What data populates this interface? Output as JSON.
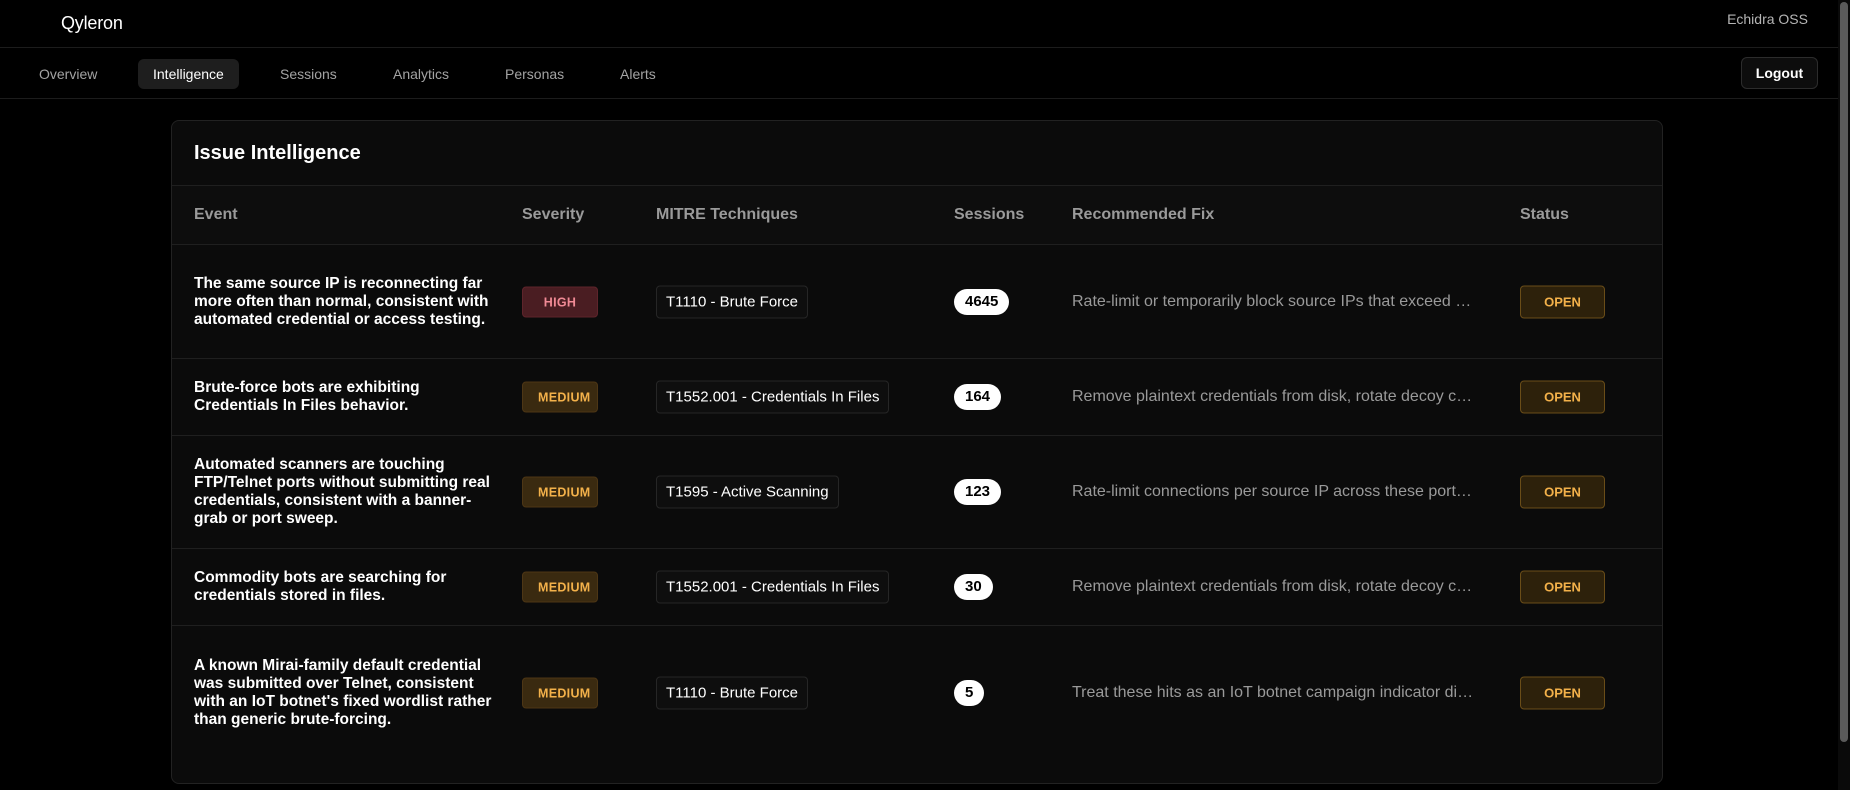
{
  "app": {
    "logo": "Qyleron",
    "org": "Echidra OSS"
  },
  "nav": {
    "tabs": [
      {
        "label": "Overview"
      },
      {
        "label": "Intelligence"
      },
      {
        "label": "Sessions"
      },
      {
        "label": "Analytics"
      },
      {
        "label": "Personas"
      },
      {
        "label": "Alerts"
      }
    ],
    "active_tab": "Intelligence",
    "logout_label": "Logout"
  },
  "card": {
    "title": "Issue Intelligence",
    "columns": [
      "Event",
      "Severity",
      "MITRE Techniques",
      "Sessions",
      "Recommended Fix",
      "Status"
    ],
    "rows": [
      {
        "event": "The same source IP is reconnecting far more often than normal, consistent with automated credential or access testing.",
        "severity": "HIGH",
        "mitre": "T1110 - Brute Force",
        "sessions": "4645",
        "fix": "Rate-limit or temporarily block source IPs that exceed …",
        "status": "OPEN"
      },
      {
        "event": "Brute-force bots are exhibiting Credentials In Files behavior.",
        "severity": "MEDIUM",
        "mitre": "T1552.001 - Credentials In Files",
        "sessions": "164",
        "fix": "Remove plaintext credentials from disk, rotate decoy c…",
        "status": "OPEN"
      },
      {
        "event": "Automated scanners are touching FTP/Telnet ports without submitting real credentials, consistent with a banner-grab or port sweep.",
        "severity": "MEDIUM",
        "mitre": "T1595 - Active Scanning",
        "sessions": "123",
        "fix": "Rate-limit connections per source IP across these port…",
        "status": "OPEN"
      },
      {
        "event": "Commodity bots are searching for credentials stored in files.",
        "severity": "MEDIUM",
        "mitre": "T1552.001 - Credentials In Files",
        "sessions": "30",
        "fix": "Remove plaintext credentials from disk, rotate decoy c…",
        "status": "OPEN"
      },
      {
        "event": "A known Mirai-family default credential was submitted over Telnet, consistent with an IoT botnet's fixed wordlist rather than generic brute-forcing.",
        "severity": "MEDIUM",
        "mitre": "T1110 - Brute Force",
        "sessions": "5",
        "fix": "Treat these hits as an IoT botnet campaign indicator di…",
        "status": "OPEN"
      }
    ]
  },
  "colors": {
    "background": "#000000",
    "card": "#0b0b0b",
    "severity_high": "#f08a95",
    "severity_medium": "#f3b14a",
    "status_open": "#f3b14a"
  }
}
